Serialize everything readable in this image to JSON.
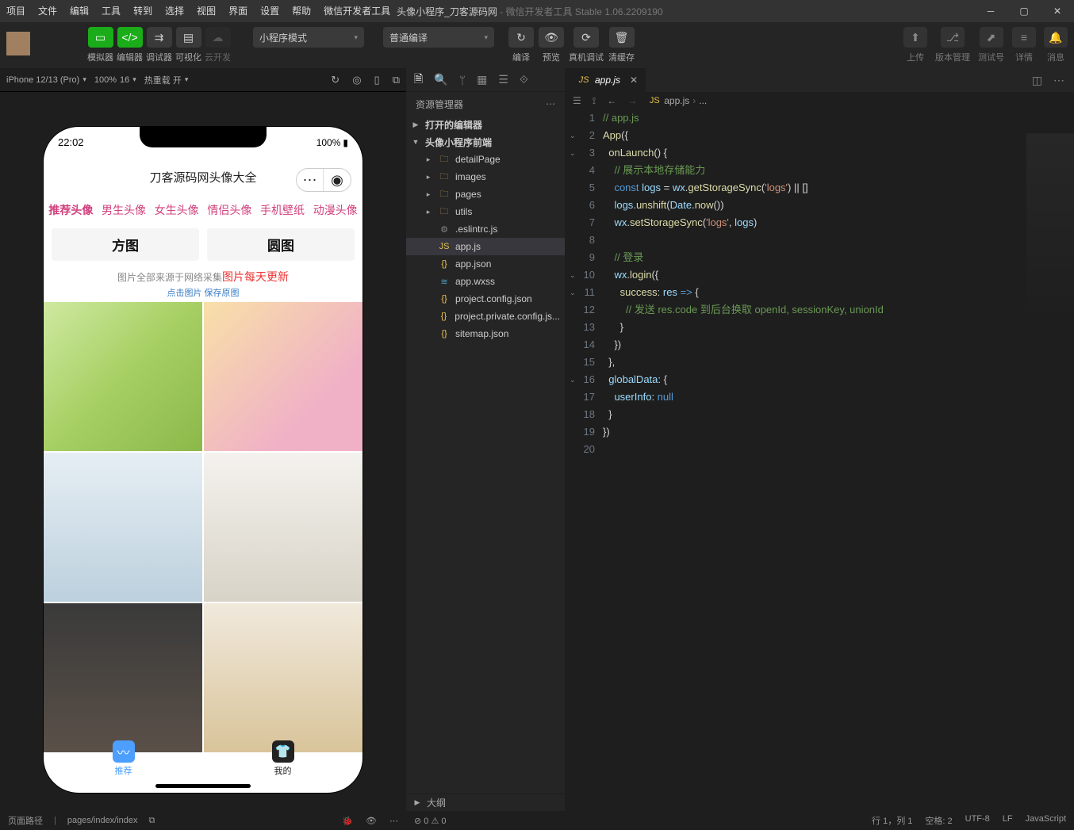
{
  "title": {
    "app": "头像小程序_刀客源码网",
    "suffix": " - 微信开发者工具 Stable 1.06.2209190"
  },
  "menus": [
    "项目",
    "文件",
    "编辑",
    "工具",
    "转到",
    "选择",
    "视图",
    "界面",
    "设置",
    "帮助",
    "微信开发者工具"
  ],
  "toolbar": {
    "groups": [
      [
        "模拟器",
        "编辑器",
        "调试器",
        "可视化",
        "云开发"
      ]
    ],
    "mode": "小程序模式",
    "compile": "普通编译",
    "center": [
      "编译",
      "预览",
      "真机调试",
      "清缓存"
    ],
    "right": [
      "上传",
      "版本管理",
      "测试号",
      "详情",
      "消息"
    ]
  },
  "simbar": {
    "device": "iPhone 12/13 (Pro)",
    "zoom": "100%",
    "fs": "16",
    "reload": "热重载 开"
  },
  "phone": {
    "time": "22:02",
    "battery": "100%",
    "title": "刀客源码网头像大全",
    "tabs": [
      "推荐头像",
      "男生头像",
      "女生头像",
      "情侣头像",
      "手机壁纸",
      "动漫头像"
    ],
    "shape": [
      "方图",
      "圆图"
    ],
    "notice_a": "图片全部来源于网络采集",
    "notice_b": "图片每天更新",
    "notice2": "点击图片 保存原图",
    "nav": [
      {
        "icon": "〰",
        "label": "推荐"
      },
      {
        "icon": "👕",
        "label": "我的"
      }
    ]
  },
  "explorer": {
    "title": "资源管理器",
    "sections": {
      "open": "打开的编辑器",
      "project": "头像小程序前端",
      "outline": "大纲"
    },
    "tree": [
      {
        "d": 1,
        "t": "folder",
        "n": "detailPage"
      },
      {
        "d": 1,
        "t": "folder",
        "n": "images"
      },
      {
        "d": 1,
        "t": "folder",
        "n": "pages"
      },
      {
        "d": 1,
        "t": "folder",
        "n": "utils"
      },
      {
        "d": 1,
        "t": "gear",
        "n": ".eslintrc.js"
      },
      {
        "d": 1,
        "t": "js",
        "n": "app.js",
        "sel": true
      },
      {
        "d": 1,
        "t": "json",
        "n": "app.json"
      },
      {
        "d": 1,
        "t": "wxss",
        "n": "app.wxss"
      },
      {
        "d": 1,
        "t": "json",
        "n": "project.config.json"
      },
      {
        "d": 1,
        "t": "json",
        "n": "project.private.config.js..."
      },
      {
        "d": 1,
        "t": "json",
        "n": "sitemap.json"
      }
    ]
  },
  "editor": {
    "tab": "app.js",
    "crumb": [
      "app.js",
      "..."
    ],
    "lines": [
      {
        "n": 1,
        "h": "<span class='c-cm'>// app.js</span>"
      },
      {
        "n": 2,
        "f": "v",
        "h": "<span class='cpk'>App</span>({"
      },
      {
        "n": 3,
        "f": "v",
        "h": "  <span class='cpk'>onLaunch</span>() {"
      },
      {
        "n": 4,
        "h": "    <span class='c-cm'>// 展示本地存储能力</span>"
      },
      {
        "n": 5,
        "h": "    <span class='c-kw'>const</span> <span class='c-pr'>logs</span> = <span class='c-pr'>wx</span>.<span class='cpk'>getStorageSync</span>(<span class='c-st'>'logs'</span>) || []"
      },
      {
        "n": 6,
        "h": "    <span class='c-pr'>logs</span>.<span class='cpk'>unshift</span>(<span class='c-pr'>Date</span>.<span class='cpk'>now</span>())"
      },
      {
        "n": 7,
        "h": "    <span class='c-pr'>wx</span>.<span class='cpk'>setStorageSync</span>(<span class='c-st'>'logs'</span>, <span class='c-pr'>logs</span>)"
      },
      {
        "n": 8,
        "h": ""
      },
      {
        "n": 9,
        "h": "    <span class='c-cm'>// 登录</span>"
      },
      {
        "n": 10,
        "f": "v",
        "h": "    <span class='c-pr'>wx</span>.<span class='cpk'>login</span>({"
      },
      {
        "n": 11,
        "f": "v",
        "h": "      <span class='cpk'>success</span>: <span class='c-pr'>res</span> <span class='c-kw'>=&gt;</span> {"
      },
      {
        "n": 12,
        "h": "        <span class='c-cm'>// 发送 res.code 到后台换取 openId, sessionKey, unionId</span>"
      },
      {
        "n": 13,
        "h": "      }"
      },
      {
        "n": 14,
        "h": "    })"
      },
      {
        "n": 15,
        "h": "  },"
      },
      {
        "n": 16,
        "f": "v",
        "h": "  <span class='c-pr'>globalData</span>: {"
      },
      {
        "n": 17,
        "h": "    <span class='c-pr'>userInfo</span>: <span class='c-kw'>null</span>"
      },
      {
        "n": 18,
        "h": "  }"
      },
      {
        "n": 19,
        "h": "})"
      },
      {
        "n": 20,
        "h": ""
      }
    ]
  },
  "status": {
    "left": [
      "页面路径",
      "pages/index/index"
    ],
    "mid": "⊘ 0 ⚠ 0",
    "right": [
      "行 1，列 1",
      "空格: 2",
      "UTF-8",
      "LF",
      "JavaScript"
    ]
  }
}
